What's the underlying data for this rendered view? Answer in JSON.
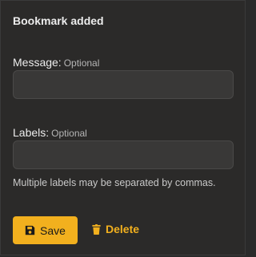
{
  "dialog": {
    "title": "Bookmark added"
  },
  "message": {
    "label": "Message:",
    "optional": "Optional",
    "value": "",
    "placeholder": ""
  },
  "labels": {
    "label": "Labels:",
    "optional": "Optional",
    "value": "",
    "placeholder": "",
    "hint": "Multiple labels may be separated by commas."
  },
  "actions": {
    "save_label": "Save",
    "save_icon": "save-disk-icon",
    "delete_label": "Delete",
    "delete_icon": "trash-icon"
  },
  "colors": {
    "accent": "#f2b01e",
    "background": "#2b2a29",
    "input_bg": "#393837"
  }
}
